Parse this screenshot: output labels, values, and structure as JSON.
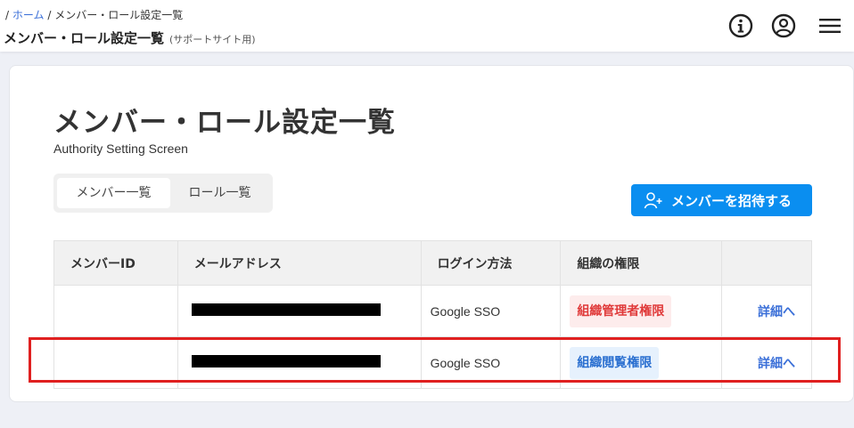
{
  "breadcrumb": {
    "sep": "/",
    "home": "ホーム",
    "current": "/ メンバー・ロール設定一覧"
  },
  "header": {
    "title": "メンバー・ロール設定一覧",
    "subtitle": "(サポートサイト用)"
  },
  "icons": {
    "info": "info-icon",
    "account": "account-icon",
    "menu": "menu-icon"
  },
  "page": {
    "title": "メンバー・ロール設定一覧",
    "subtitle": "Authority Setting Screen"
  },
  "tabs": [
    {
      "label": "メンバー一覧",
      "active": true
    },
    {
      "label": "ロール一覧",
      "active": false
    }
  ],
  "invite_button": {
    "label": "メンバーを招待する"
  },
  "table": {
    "headers": [
      "メンバーID",
      "メールアドレス",
      "ログイン方法",
      "組織の権限",
      ""
    ],
    "rows": [
      {
        "member_id": "",
        "email": "[redacted]",
        "login": "Google SSO",
        "role": "組織管理者権限",
        "role_type": "admin",
        "action": "詳細へ"
      },
      {
        "member_id": "",
        "email": "[redacted]",
        "login": "Google SSO",
        "role": "組織閲覧権限",
        "role_type": "view",
        "action": "詳細へ"
      }
    ]
  },
  "colors": {
    "accent": "#0a8ef0",
    "admin_badge": "#e03a3a",
    "view_badge": "#2a6fd0",
    "highlight": "#e02020",
    "link": "#3a6fd8"
  }
}
